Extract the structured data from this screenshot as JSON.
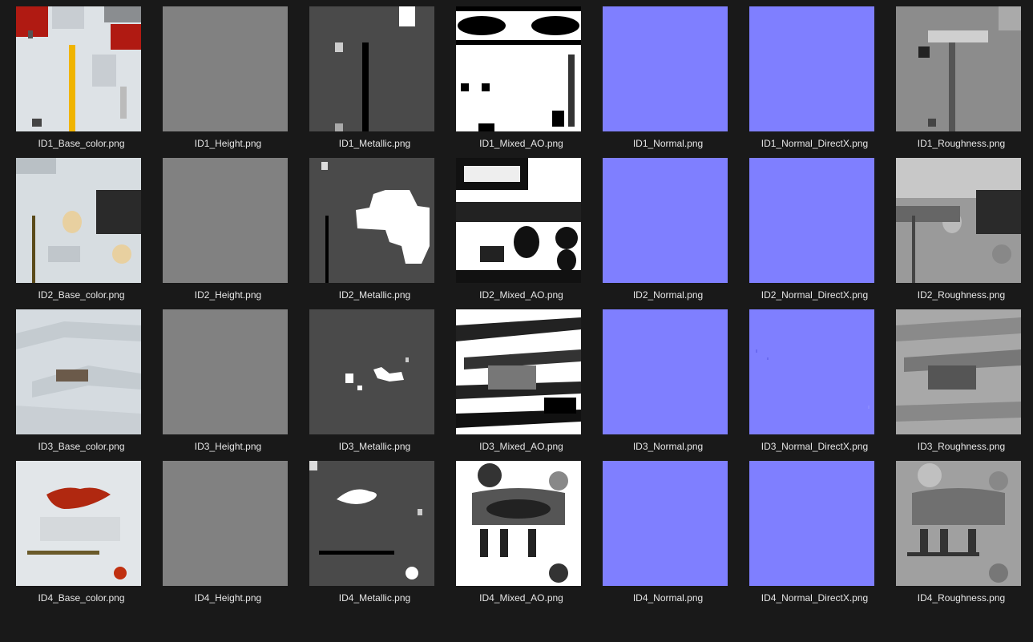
{
  "rows": [
    {
      "files": [
        {
          "name": "ID1_Base_color.png",
          "kind": "base_color"
        },
        {
          "name": "ID1_Height.png",
          "kind": "height"
        },
        {
          "name": "ID1_Metallic.png",
          "kind": "metallic"
        },
        {
          "name": "ID1_Mixed_AO.png",
          "kind": "mixed_ao"
        },
        {
          "name": "ID1_Normal.png",
          "kind": "normal"
        },
        {
          "name": "ID1_Normal_DirectX.png",
          "kind": "normal"
        },
        {
          "name": "ID1_Roughness.png",
          "kind": "roughness"
        }
      ]
    },
    {
      "files": [
        {
          "name": "ID2_Base_color.png",
          "kind": "base_color"
        },
        {
          "name": "ID2_Height.png",
          "kind": "height"
        },
        {
          "name": "ID2_Metallic.png",
          "kind": "metallic"
        },
        {
          "name": "ID2_Mixed_AO.png",
          "kind": "mixed_ao"
        },
        {
          "name": "ID2_Normal.png",
          "kind": "normal"
        },
        {
          "name": "ID2_Normal_DirectX.png",
          "kind": "normal"
        },
        {
          "name": "ID2_Roughness.png",
          "kind": "roughness"
        }
      ]
    },
    {
      "files": [
        {
          "name": "ID3_Base_color.png",
          "kind": "base_color"
        },
        {
          "name": "ID3_Height.png",
          "kind": "height"
        },
        {
          "name": "ID3_Metallic.png",
          "kind": "metallic"
        },
        {
          "name": "ID3_Mixed_AO.png",
          "kind": "mixed_ao"
        },
        {
          "name": "ID3_Normal.png",
          "kind": "normal"
        },
        {
          "name": "ID3_Normal_DirectX.png",
          "kind": "normal"
        },
        {
          "name": "ID3_Roughness.png",
          "kind": "roughness"
        }
      ]
    },
    {
      "files": [
        {
          "name": "ID4_Base_color.png",
          "kind": "base_color"
        },
        {
          "name": "ID4_Height.png",
          "kind": "height"
        },
        {
          "name": "ID4_Metallic.png",
          "kind": "metallic"
        },
        {
          "name": "ID4_Mixed_AO.png",
          "kind": "mixed_ao"
        },
        {
          "name": "ID4_Normal.png",
          "kind": "normal"
        },
        {
          "name": "ID4_Normal_DirectX.png",
          "kind": "normal"
        },
        {
          "name": "ID4_Roughness.png",
          "kind": "roughness"
        }
      ]
    }
  ],
  "colors": {
    "background": "#191919",
    "label_text": "#e6e6e6",
    "normal_map": "#7f7fff",
    "height_map": "#808080",
    "metallic_bg": "#4a4a4a",
    "base_color_bg": "#dde2e6",
    "accent_red": "#b01a12",
    "accent_yellow": "#f0b400"
  }
}
